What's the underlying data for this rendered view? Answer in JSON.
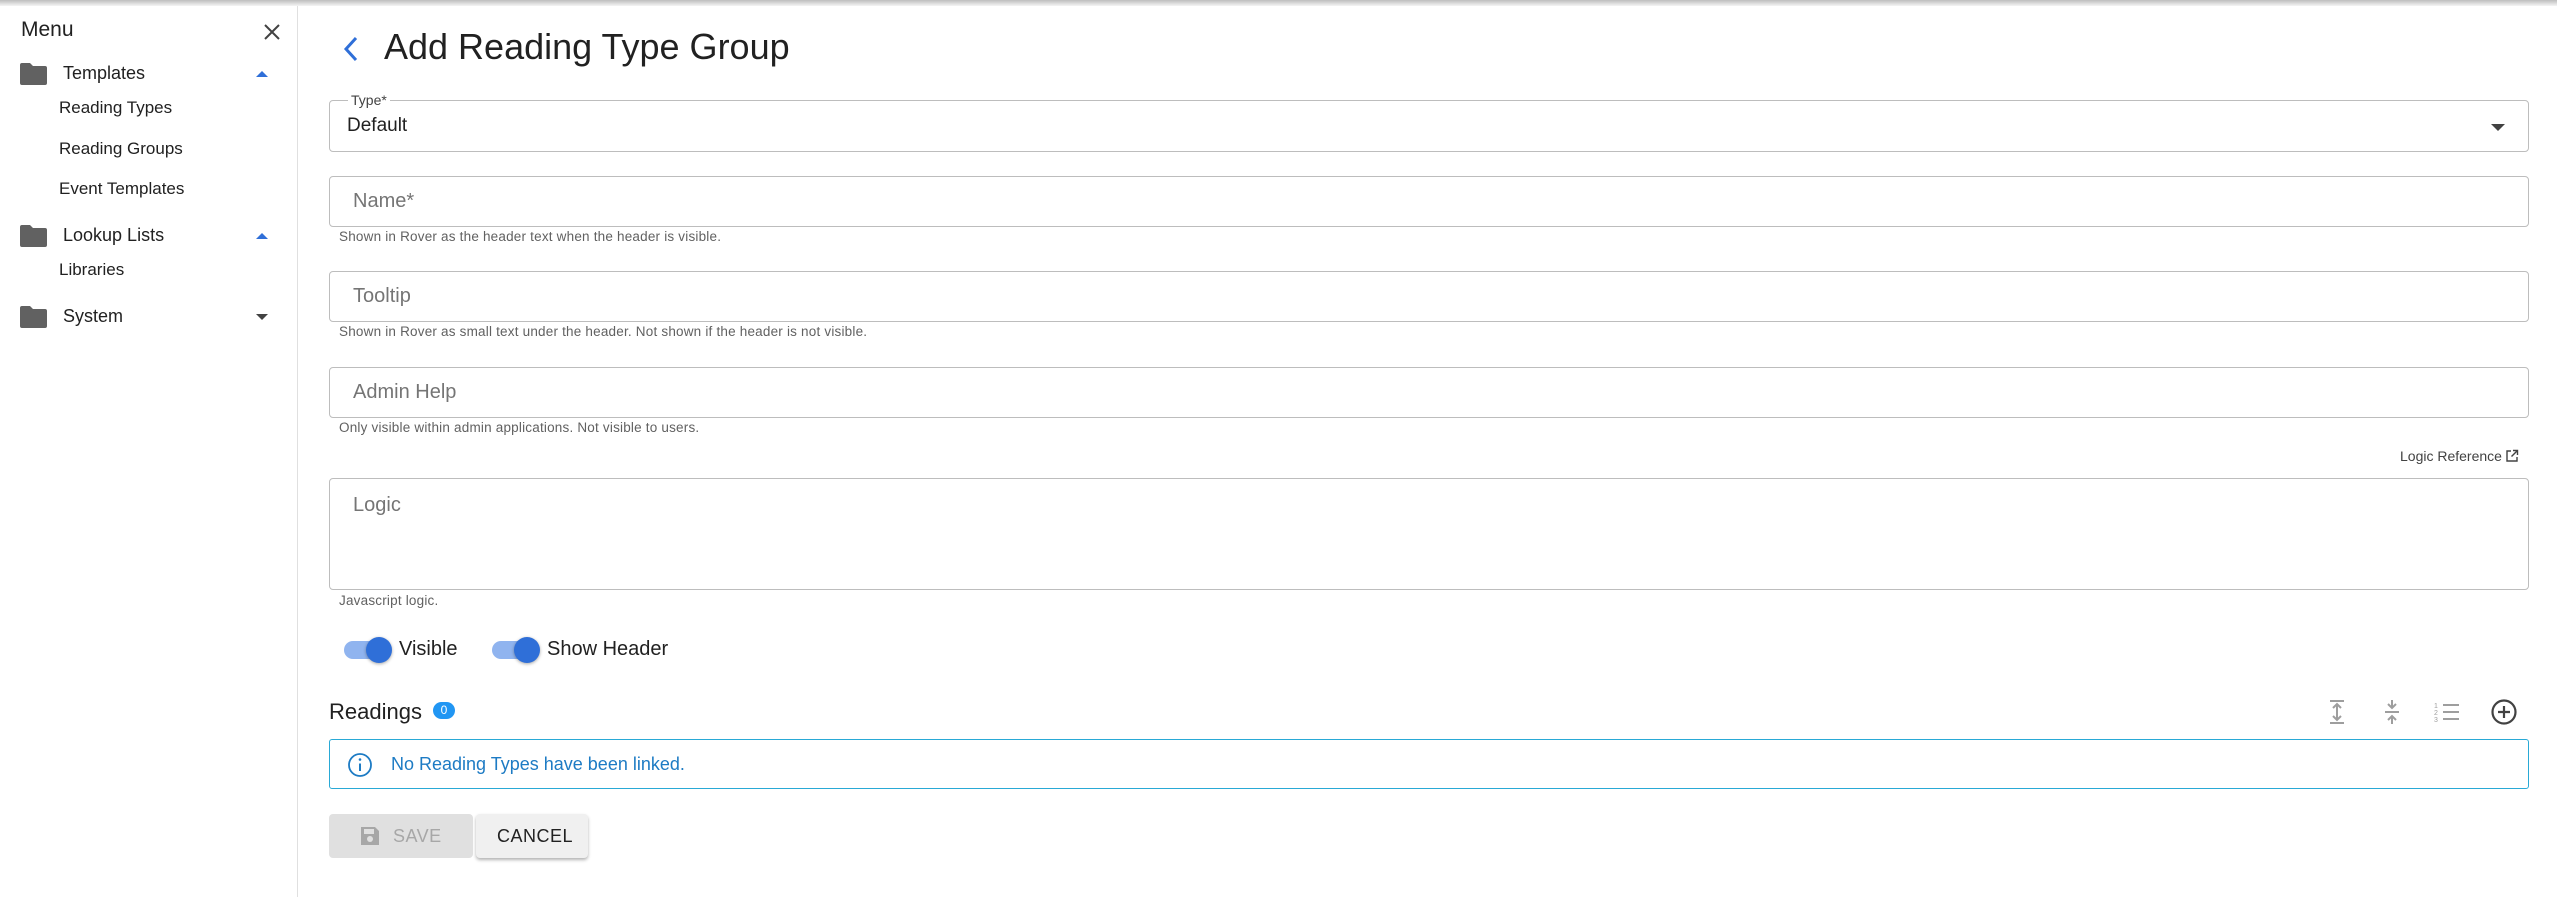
{
  "sidebar": {
    "title": "Menu",
    "groups": [
      {
        "label": "Templates",
        "expanded": true,
        "items": [
          "Reading Types",
          "Reading Groups",
          "Event Templates"
        ]
      },
      {
        "label": "Lookup Lists",
        "expanded": true,
        "items": [
          "Libraries"
        ]
      },
      {
        "label": "System",
        "expanded": false,
        "items": []
      }
    ]
  },
  "page": {
    "title": "Add Reading Type Group"
  },
  "form": {
    "type": {
      "label": "Type*",
      "value": "Default"
    },
    "name": {
      "placeholder": "Name*",
      "helper": "Shown in Rover as the header text when the header is visible."
    },
    "tooltip": {
      "placeholder": "Tooltip",
      "helper": "Shown in Rover as small text under the header. Not shown if the header is not visible."
    },
    "admin_help": {
      "placeholder": "Admin Help",
      "helper": "Only visible within admin applications. Not visible to users."
    },
    "logic_reference": "Logic Reference",
    "logic": {
      "placeholder": "Logic",
      "helper": "Javascript logic."
    },
    "toggles": {
      "visible": "Visible",
      "show_header": "Show Header"
    }
  },
  "readings": {
    "title": "Readings",
    "count": "0",
    "empty_message": "No Reading Types have been linked."
  },
  "actions": {
    "save": "SAVE",
    "cancel": "CANCEL"
  },
  "colors": {
    "accent": "#2f6fd8",
    "info": "#1d7bc4",
    "badge": "#2196f3"
  }
}
